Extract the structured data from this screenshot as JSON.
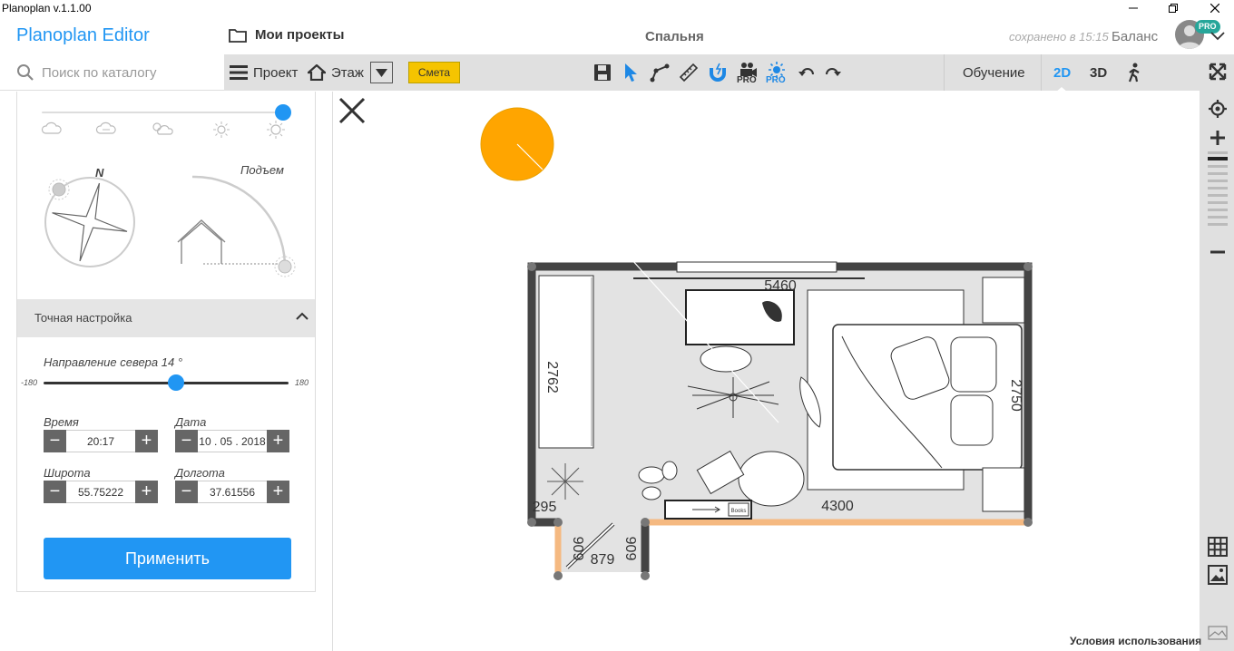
{
  "window": {
    "title": "Planoplan v.1.1.00"
  },
  "header": {
    "brand": "Planoplan Editor",
    "projects_label": "Мои проекты",
    "page_title": "Спальня",
    "saved_text": "сохранено в 15:15",
    "balance_label": "Баланс",
    "pro_badge": "PRO"
  },
  "search": {
    "placeholder": "Поиск по каталогу"
  },
  "toolbar": {
    "project_label": "Проект",
    "floor_label": "Этаж",
    "estimate_label": "Смета",
    "pro_label": "PRO",
    "tutorial_label": "Обучение",
    "view_2d": "2D",
    "view_3d": "3D",
    "accent_color": "#2196f3",
    "estimate_color": "#f5c400"
  },
  "sun_panel": {
    "weather_level": 1.0,
    "elevation_label": "Подъем",
    "compass_label": "N",
    "fine_tune_label": "Точная настройка",
    "north_direction_label": "Направление севера 14 °",
    "north_min": "-180",
    "north_max": "180",
    "north_value": 14,
    "time_label": "Время",
    "time_value": "20:17",
    "date_label": "Дата",
    "date_value": "10 . 05 . 2018",
    "latitude_label": "Широта",
    "latitude_value": "55.75222",
    "longitude_label": "Долгота",
    "longitude_value": "37.61556",
    "apply_label": "Применить"
  },
  "plan": {
    "sun_color": "#ffa500",
    "opening_color": "#f5b981",
    "dim_top": "5460",
    "dim_left": "2762",
    "dim_right": "2750",
    "dim_bottom": "4300",
    "dim_corner": "295",
    "dim_door_width": "879",
    "dim_door_left": "909",
    "dim_door_right": "909",
    "books_label": "Books"
  },
  "footer": {
    "terms_label": "Условия использования"
  }
}
